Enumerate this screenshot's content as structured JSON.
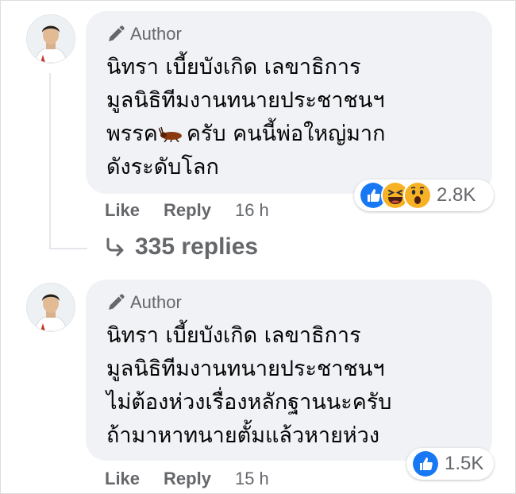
{
  "comments": [
    {
      "author_badge": "Author",
      "lines": [
        "นิทรา เบี้ยบังเกิด เลขาธิการ",
        "มูลนิธิทีมงานทนายประชาชนฯ",
        "พรรค",
        "ดังระดับโลก"
      ],
      "line3_suffix": "ครับ คนนี้พ่อใหญ่มาก",
      "reactions": [
        "like-icon",
        "haha-icon",
        "wow-icon"
      ],
      "reaction_count": "2.8K",
      "like_label": "Like",
      "reply_label": "Reply",
      "time": "16 h"
    },
    {
      "author_badge": "Author",
      "lines": [
        "นิทรา เบี้ยบังเกิด เลขาธิการ",
        "มูลนิธิทีมงานทนายประชาชนฯ",
        "ไม่ต้องห่วงเรื่องหลักฐานนะครับ",
        "ถ้ามาหาทนายตั้มแล้วหายห่วง"
      ],
      "reactions": [
        "like-icon"
      ],
      "reaction_count": "1.5K",
      "like_label": "Like",
      "reply_label": "Reply",
      "time": "15 h"
    }
  ],
  "replies": {
    "label": "335 replies",
    "icon": "reply-arrow-icon"
  },
  "colors": {
    "bubble": "#f0f2f5",
    "meta": "#65676b",
    "text": "#050505",
    "like_blue": "#1877f2",
    "reaction_yellow": "#f7b125"
  }
}
